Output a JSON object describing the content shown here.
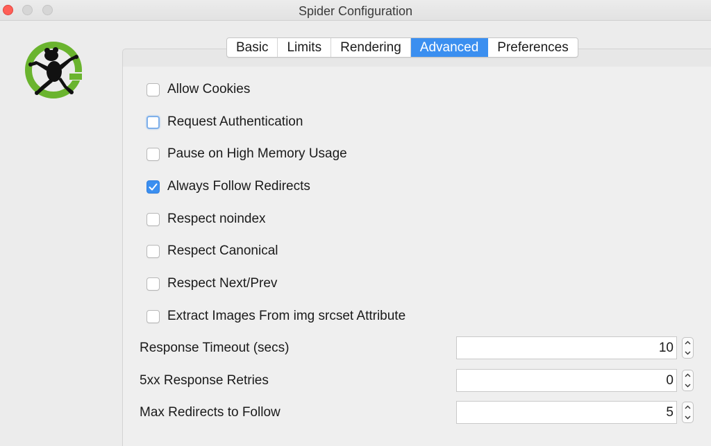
{
  "window": {
    "title": "Spider Configuration"
  },
  "tabs": [
    {
      "label": "Basic",
      "active": false
    },
    {
      "label": "Limits",
      "active": false
    },
    {
      "label": "Rendering",
      "active": false
    },
    {
      "label": "Advanced",
      "active": true
    },
    {
      "label": "Preferences",
      "active": false
    }
  ],
  "logo": {
    "icon": "frog-logo-icon",
    "color": "#6ab42e"
  },
  "options": [
    {
      "label": "Allow Cookies",
      "checked": false
    },
    {
      "label": "Request Authentication",
      "checked": false,
      "focused": true
    },
    {
      "label": "Pause on High Memory Usage",
      "checked": false
    },
    {
      "label": "Always Follow Redirects",
      "checked": true
    },
    {
      "label": "Respect noindex",
      "checked": false
    },
    {
      "label": "Respect Canonical",
      "checked": false
    },
    {
      "label": "Respect Next/Prev",
      "checked": false
    },
    {
      "label": "Extract Images From img srcset Attribute",
      "checked": false
    }
  ],
  "fields": [
    {
      "label": "Response Timeout (secs)",
      "value": "10"
    },
    {
      "label": "5xx Response Retries",
      "value": "0"
    },
    {
      "label": "Max Redirects to Follow",
      "value": "5"
    }
  ],
  "colors": {
    "accent": "#3b8ff0",
    "close": "#ff5f57"
  }
}
